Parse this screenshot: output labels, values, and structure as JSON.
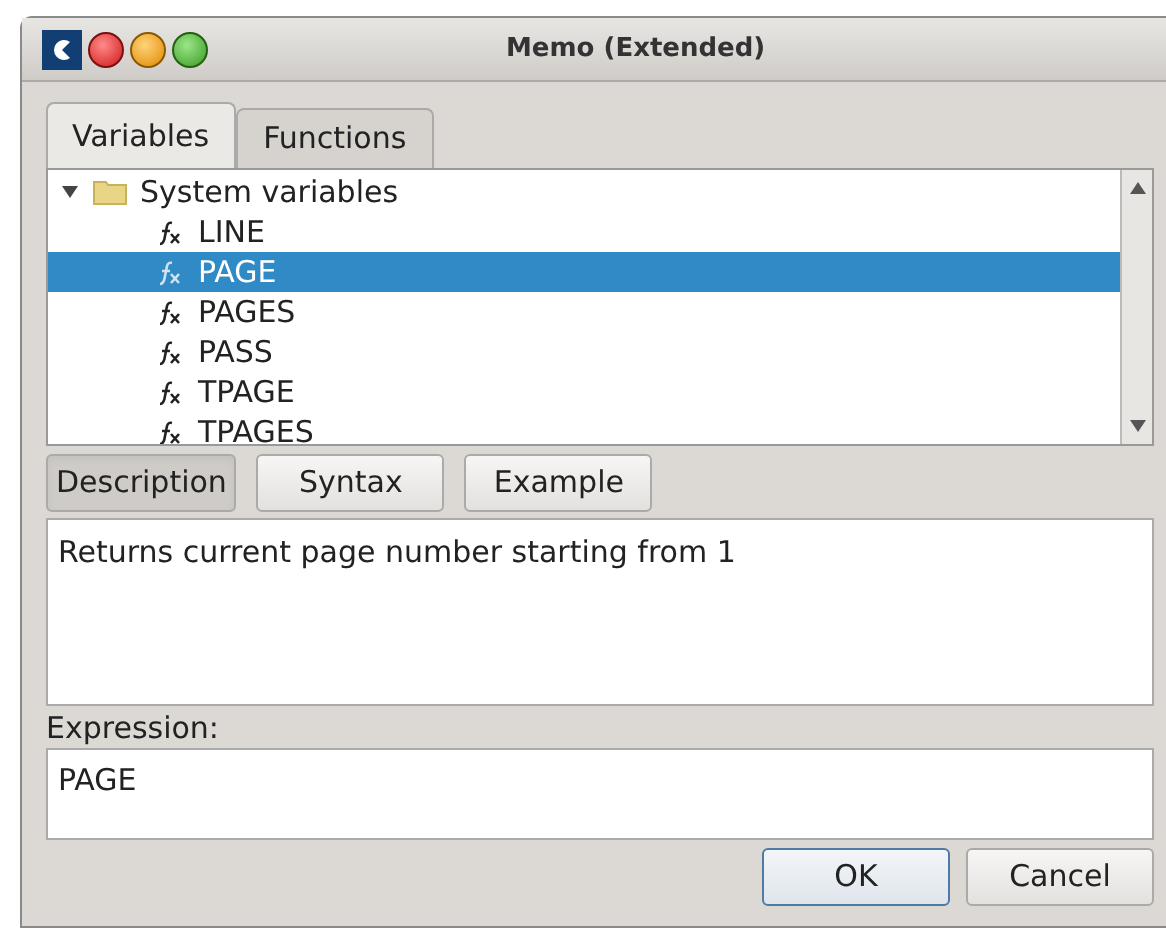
{
  "window": {
    "title": "Memo (Extended)"
  },
  "tabs": [
    {
      "label": "Variables",
      "selected": true
    },
    {
      "label": "Functions",
      "selected": false
    }
  ],
  "tree": [
    {
      "label": "System variables",
      "expanded": true,
      "selected": false,
      "children": [
        {
          "label": "LINE",
          "selected": false
        },
        {
          "label": "PAGE",
          "selected": true
        },
        {
          "label": "PAGES",
          "selected": false
        },
        {
          "label": "PASS",
          "selected": false
        },
        {
          "label": "TPAGE",
          "selected": false
        },
        {
          "label": "TPAGES",
          "selected": false
        }
      ]
    }
  ],
  "info_tabs": [
    {
      "label": "Description",
      "selected": true
    },
    {
      "label": "Syntax",
      "selected": false
    },
    {
      "label": "Example",
      "selected": false
    }
  ],
  "description": "Returns current page number starting from 1",
  "expression": {
    "label": "Expression:",
    "value": "PAGE"
  },
  "buttons": [
    {
      "label": "OK",
      "default": true
    },
    {
      "label": "Cancel",
      "default": false
    }
  ]
}
